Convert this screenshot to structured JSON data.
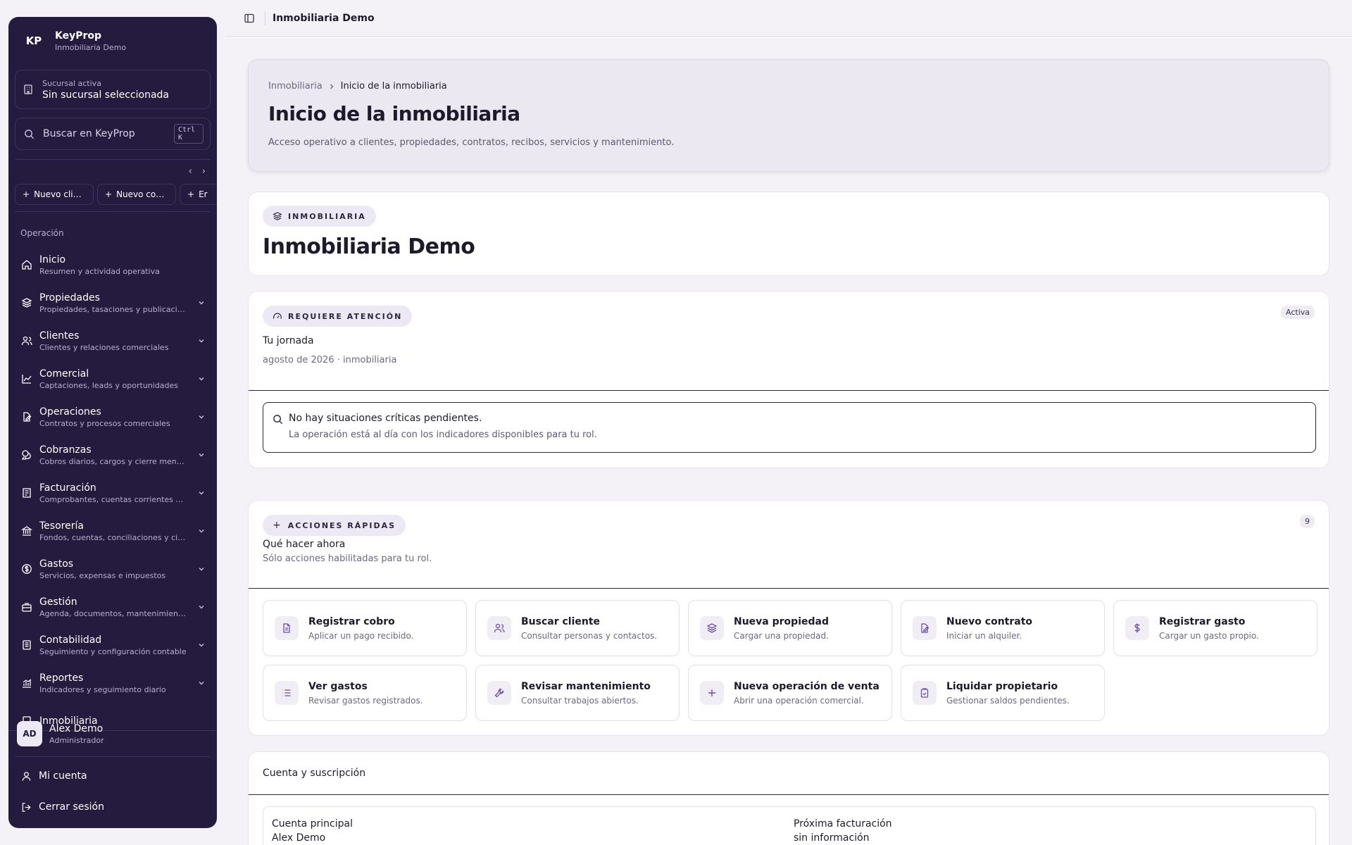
{
  "brand": {
    "logo": "KP",
    "name": "KeyProp",
    "company": "Inmobiliaria Demo"
  },
  "branch": {
    "label": "Sucursal activa",
    "value": "Sin sucursal seleccionada"
  },
  "search": {
    "placeholder": "Buscar en KeyProp",
    "shortcut": "Ctrl K"
  },
  "quick_create": [
    {
      "label": "Nuevo clien..."
    },
    {
      "label": "Nuevo cont..."
    },
    {
      "label": "Er"
    }
  ],
  "nav": {
    "section": "Operación",
    "items": [
      {
        "title": "Inicio",
        "sub": "Resumen y actividad operativa",
        "icon": "home-icon"
      },
      {
        "title": "Propiedades",
        "sub": "Propiedades, tasaciones y publicaciones",
        "icon": "layers-icon"
      },
      {
        "title": "Clientes",
        "sub": "Clientes y relaciones comerciales",
        "icon": "users-icon"
      },
      {
        "title": "Comercial",
        "sub": "Captaciones, leads y oportunidades",
        "icon": "chart-icon"
      },
      {
        "title": "Operaciones",
        "sub": "Contratos y procesos comerciales",
        "icon": "file-edit-icon"
      },
      {
        "title": "Cobranzas",
        "sub": "Cobros diarios, cargos y cierre mensual",
        "icon": "coins-icon"
      },
      {
        "title": "Facturación",
        "sub": "Comprobantes, cuentas corrientes y c...",
        "icon": "receipt-icon"
      },
      {
        "title": "Tesorería",
        "sub": "Fondos, cuentas, conciliaciones y cierr...",
        "icon": "bank-icon"
      },
      {
        "title": "Gastos",
        "sub": "Servicios, expensas e impuestos",
        "icon": "dollar-circle-icon"
      },
      {
        "title": "Gestión",
        "sub": "Agenda, documentos, mantenimiento y ...",
        "icon": "briefcase-icon"
      },
      {
        "title": "Contabilidad",
        "sub": "Seguimiento y configuración contable",
        "icon": "ledger-icon"
      },
      {
        "title": "Reportes",
        "sub": "Indicadores y seguimiento diario",
        "icon": "report-chart-icon"
      },
      {
        "title": "Inmobiliaria",
        "sub": "",
        "icon": "building-icon"
      }
    ]
  },
  "user": {
    "initials": "AD",
    "name": "Alex Demo",
    "role": "Administrador"
  },
  "footer_links": {
    "account": "Mi cuenta",
    "logout": "Cerrar sesión"
  },
  "topbar": {
    "title": "Inmobiliaria Demo"
  },
  "hero": {
    "breadcrumb_root": "Inmobiliaria",
    "breadcrumb_current": "Inicio de la inmobiliaria",
    "title": "Inicio de la inmobiliaria",
    "subtitle": "Acceso operativo a clientes, propiedades, contratos, recibos, servicios y mantenimiento."
  },
  "company_card": {
    "badge": "INMOBILIARIA",
    "name": "Inmobiliaria Demo"
  },
  "attention": {
    "badge": "REQUIERE ATENCIÓN",
    "status": "Activa",
    "title": "Tu jornada",
    "subtitle": "agosto de 2026 · inmobiliaria",
    "alert_title": "No hay situaciones críticas pendientes.",
    "alert_sub": "La operación está al día con los indicadores disponibles para tu rol."
  },
  "quick_actions": {
    "badge": "ACCIONES RÁPIDAS",
    "count": "9",
    "title": "Qué hacer ahora",
    "subtitle": "Sólo acciones habilitadas para tu rol.",
    "items": [
      {
        "title": "Registrar cobro",
        "sub": "Aplicar un pago recibido.",
        "icon": "document-icon"
      },
      {
        "title": "Buscar cliente",
        "sub": "Consultar personas y contactos.",
        "icon": "users-icon"
      },
      {
        "title": "Nueva propiedad",
        "sub": "Cargar una propiedad.",
        "icon": "layers-icon"
      },
      {
        "title": "Nuevo contrato",
        "sub": "Iniciar un alquiler.",
        "icon": "file-edit-icon"
      },
      {
        "title": "Registrar gasto",
        "sub": "Cargar un gasto propio.",
        "icon": "dollar-icon"
      },
      {
        "title": "Ver gastos",
        "sub": "Revisar gastos registrados.",
        "icon": "list-icon"
      },
      {
        "title": "Revisar mantenimiento",
        "sub": "Consultar trabajos abiertos.",
        "icon": "wrench-icon"
      },
      {
        "title": "Nueva operación de venta",
        "sub": "Abrir una operación comercial.",
        "icon": "plus-icon"
      },
      {
        "title": "Liquidar propietario",
        "sub": "Gestionar saldos pendientes.",
        "icon": "clipboard-icon"
      }
    ]
  },
  "account": {
    "title": "Cuenta y suscripción",
    "main_label": "Cuenta principal",
    "main_value": "Alex Demo",
    "billing_label": "Próxima facturación",
    "billing_value": "sin información"
  },
  "colors": {
    "sidebar": "#241b3f",
    "accent": "#6b4fa8",
    "background": "#f4f2f7"
  }
}
